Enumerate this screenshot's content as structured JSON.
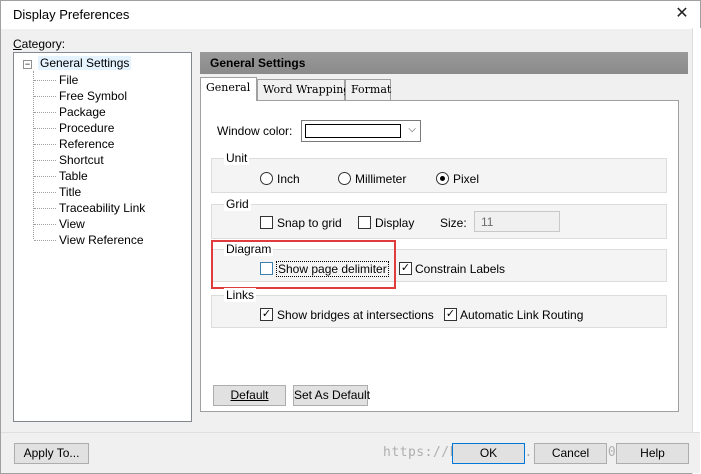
{
  "window": {
    "title": "Display Preferences",
    "close_glyph": "✕"
  },
  "category": {
    "label": "Category:",
    "root": "General Settings",
    "toggle": "−",
    "children": [
      "File",
      "Free Symbol",
      "Package",
      "Procedure",
      "Reference",
      "Shortcut",
      "Table",
      "Title",
      "Traceability Link",
      "View",
      "View Reference"
    ]
  },
  "panel": {
    "header": "General Settings",
    "tabs": [
      "General",
      "Word Wrapping",
      "Format"
    ],
    "window_color_label": "Window color:",
    "window_color_value": "#ffffff",
    "unit": {
      "title": "Unit",
      "options": [
        "Inch",
        "Millimeter",
        "Pixel"
      ],
      "selected": "Pixel"
    },
    "grid": {
      "title": "Grid",
      "snap_label": "Snap to grid",
      "display_label": "Display",
      "size_label": "Size:",
      "size_value": "11",
      "snap_checked": false,
      "display_checked": false
    },
    "diagram": {
      "title": "Diagram",
      "page_delimiter_label": "Show page delimiter",
      "constrain_labels_label": "Constrain Labels",
      "page_delimiter_checked": false,
      "constrain_labels_checked": true
    },
    "links": {
      "title": "Links",
      "bridges_label": "Show bridges at intersections",
      "routing_label": "Automatic Link Routing",
      "bridges_checked": true,
      "routing_checked": true
    },
    "default_button": "Default",
    "set_default_button": "Set As Default"
  },
  "footer": {
    "apply_to": "Apply To...",
    "ok": "OK",
    "cancel": "Cancel",
    "help": "Help",
    "watermark": "https://blog.csdn.net/csdn1011"
  },
  "colors": {
    "highlight": "#e03c3c",
    "selection": "#e5f3ff",
    "focus": "#0078d7"
  }
}
